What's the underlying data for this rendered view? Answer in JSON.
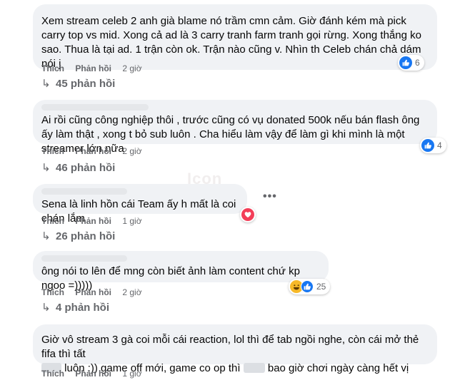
{
  "comments": [
    {
      "text": "Xem stream celeb 2 anh già blame nó trầm cmn cảm. Giờ đánh kém mà pick carry top vs mid. Xong cả ad là 3 carry tranh farm tranh gọi rừng. Xong thắng ko sao. Thua là tại ad. 1 trận còn ok. Trận nào cũng v. Nhìn th Celeb chán chả dám nói j",
      "like": "Thích",
      "reply": "Phản hồi",
      "time": "2 giờ",
      "reactions": {
        "count": "6",
        "icons": [
          "like-icon"
        ]
      },
      "replies": "45 phản hồi"
    },
    {
      "text": "Ai rồi cũng công nghiệp thôi , trước cũng có vụ donated 500k nếu bán flash ông ấy làm thật , xong t bỏ sub luôn . Cha hiểu làm vậy để làm gì khi mình là một streamer lớn nữa",
      "like": "Thích",
      "reply": "Phản hồi",
      "time": "2 giờ",
      "reactions": {
        "count": "4",
        "icons": [
          "like-icon"
        ]
      },
      "replies": "46 phản hồi"
    },
    {
      "text": "Sena là linh hồn cái Team ấy h mất là coi chán lắm",
      "like": "Thích",
      "reply": "Phản hồi",
      "time": "1 giờ",
      "reactions": {
        "count": "",
        "icons": [
          "love-icon"
        ]
      },
      "replies": "26 phản hồi",
      "more": "•••"
    },
    {
      "text": "ông nói to lên để mng còn biết ảnh làm content chứ kp ngoo =)))))",
      "like": "Thích",
      "reply": "Phản hồi",
      "time": "2 giờ",
      "reactions": {
        "count": "25",
        "icons": [
          "haha-icon",
          "like-icon"
        ]
      },
      "replies": "4 phản hồi"
    },
    {
      "text_parts": [
        "Giờ vô stream 3 gà coi mỗi cái reaction, lol thì để tab ngồi nghe, còn cái mở thẻ fifa thì tất",
        "luôn :)) game off mới, game co op thì",
        "bao giờ chơi ngày càng hết vị"
      ],
      "like": "Thích",
      "reply": "Phản hồi",
      "time": "1 giờ"
    }
  ],
  "watermark": "Icon",
  "colors": {
    "bubble": "#f0f2f5",
    "meta": "#65676b",
    "like": "#1877f2",
    "love": "#f33e58",
    "haha": "#f7b928"
  }
}
